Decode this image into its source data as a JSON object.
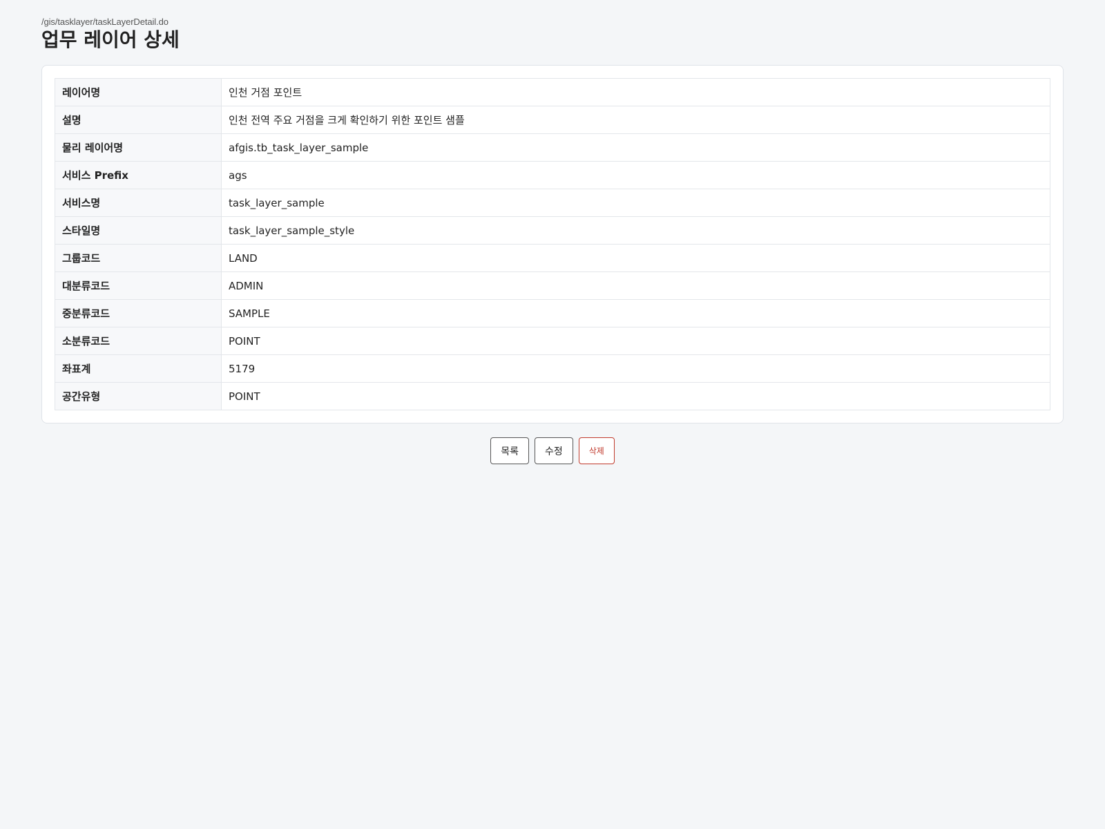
{
  "header": {
    "path": "/gis/tasklayer/taskLayerDetail.do",
    "title": "업무 레이어 상세"
  },
  "detail": {
    "rows": [
      {
        "label": "레이어명",
        "value": "인천 거점 포인트"
      },
      {
        "label": "설명",
        "value": "인천 전역 주요 거점을 크게 확인하기 위한 포인트 샘플"
      },
      {
        "label": "물리 레이어명",
        "value": "afgis.tb_task_layer_sample"
      },
      {
        "label": "서비스 Prefix",
        "value": "ags"
      },
      {
        "label": "서비스명",
        "value": "task_layer_sample"
      },
      {
        "label": "스타일명",
        "value": "task_layer_sample_style"
      },
      {
        "label": "그룹코드",
        "value": "LAND"
      },
      {
        "label": "대분류코드",
        "value": "ADMIN"
      },
      {
        "label": "중분류코드",
        "value": "SAMPLE"
      },
      {
        "label": "소분류코드",
        "value": "POINT"
      },
      {
        "label": "좌표계",
        "value": "5179"
      },
      {
        "label": "공간유형",
        "value": "POINT"
      }
    ]
  },
  "actions": {
    "list_label": "목록",
    "edit_label": "수정",
    "delete_label": "삭제"
  },
  "colors": {
    "background": "#f4f6f8",
    "danger": "#c0392b"
  }
}
